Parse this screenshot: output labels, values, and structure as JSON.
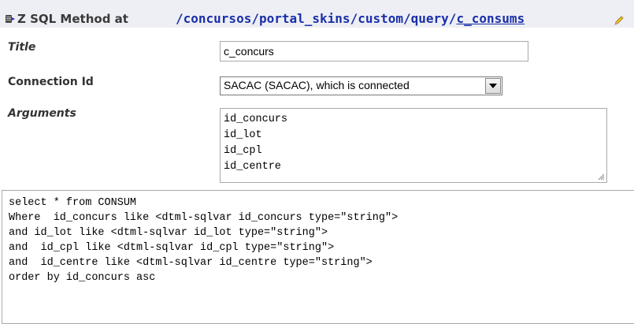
{
  "header": {
    "title_prefix": "Z SQL Method at",
    "path_segments": [
      "/concursos",
      "/portal_skins",
      "/custom",
      "/query",
      "/"
    ],
    "path_last": "c_consums",
    "icon": "zsql-method-icon",
    "edit_icon": "pencil-icon"
  },
  "form": {
    "title_label": "Title",
    "title_value": "c_concurs",
    "connection_label": "Connection Id",
    "connection_value": "SACAC (SACAC), which is connected",
    "arguments_label": "Arguments",
    "arguments": [
      "id_concurs",
      "id_lot",
      "id_cpl",
      "id_centre"
    ]
  },
  "template": {
    "lines": [
      "select * from CONSUM",
      "Where  id_concurs like <dtml-sqlvar id_concurs type=\"string\">",
      "and id_lot like <dtml-sqlvar id_lot type=\"string\">",
      "and  id_cpl like <dtml-sqlvar id_cpl type=\"string\">",
      "and  id_centre like <dtml-sqlvar id_centre type=\"string\">",
      "order by id_concurs asc"
    ]
  }
}
